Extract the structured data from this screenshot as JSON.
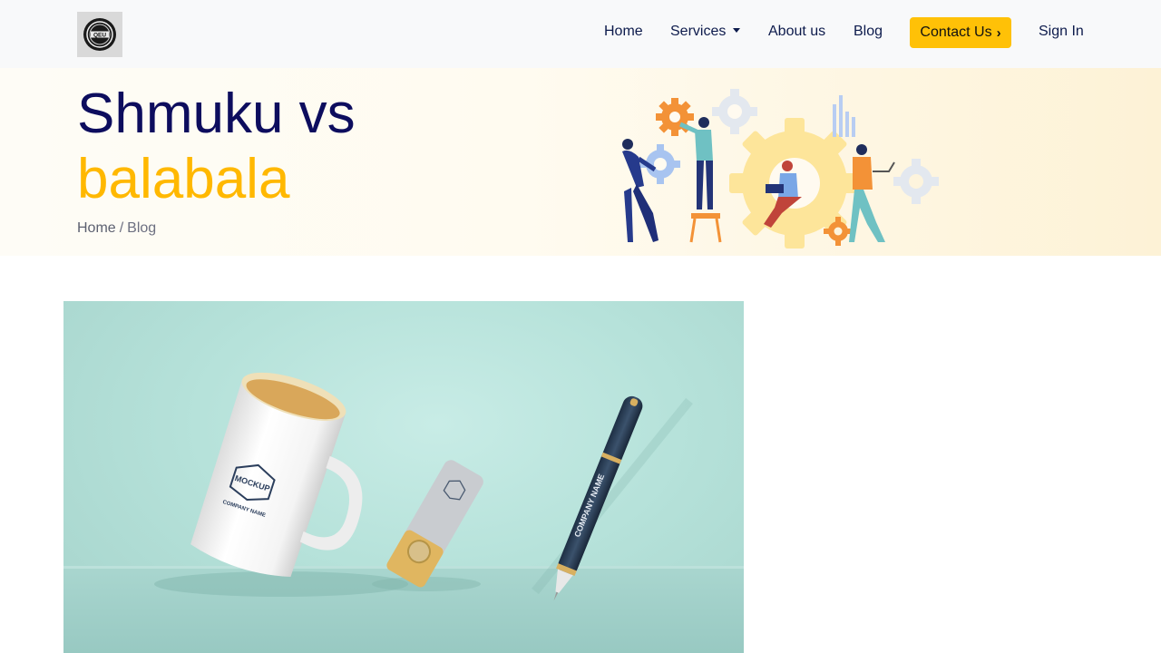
{
  "brand": {
    "logo_text": "QEU"
  },
  "nav": {
    "home": "Home",
    "services": "Services",
    "about": "About us",
    "blog": "Blog",
    "contact": "Contact Us",
    "signin": "Sign In"
  },
  "hero": {
    "title_line1": "Shmuku vs",
    "title_line2": "balabala",
    "breadcrumb": {
      "home": "Home",
      "separator": "/",
      "current": "Blog"
    }
  },
  "feature_image": {
    "mug_logo": "MOCKUP",
    "mug_company": "COMPANY NAME",
    "pen_text": "COMPANY NAME"
  },
  "colors": {
    "accent": "#ffc107",
    "title": "#0d0d5e",
    "highlight": "#ffb800",
    "nav_text": "#0d1b4c"
  }
}
